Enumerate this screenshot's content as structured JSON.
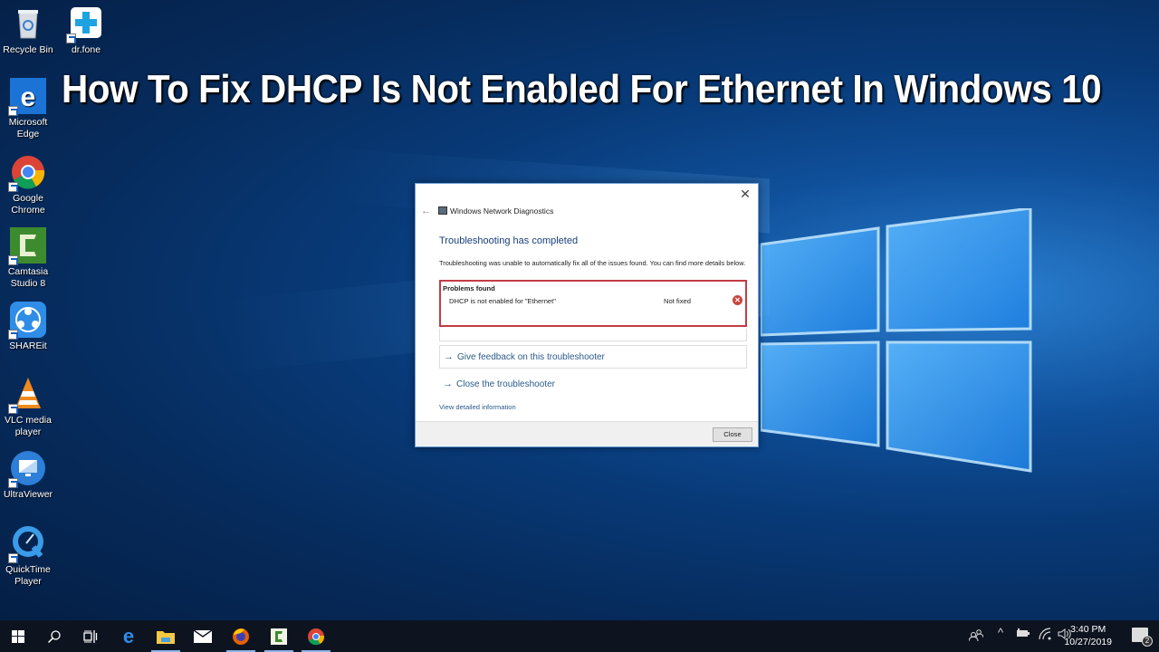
{
  "banner": {
    "title": "How To Fix DHCP Is Not Enabled For Ethernet In Windows 10"
  },
  "desktop_icons": [
    {
      "label": "Recycle Bin",
      "icon": "recycle-bin-icon"
    },
    {
      "label": "dr.fone",
      "icon": "drfone-icon"
    },
    {
      "label": "Microsoft Edge",
      "icon": "edge-icon"
    },
    {
      "label": "Google Chrome",
      "icon": "chrome-icon"
    },
    {
      "label": "Camtasia Studio 8",
      "icon": "camtasia-icon"
    },
    {
      "label": "SHAREit",
      "icon": "shareit-icon"
    },
    {
      "label": "VLC media player",
      "icon": "vlc-icon"
    },
    {
      "label": "UltraViewer",
      "icon": "ultraviewer-icon"
    },
    {
      "label": "QuickTime Player",
      "icon": "quicktime-icon"
    }
  ],
  "dialog": {
    "app_title": "Windows Network Diagnostics",
    "close_glyph": "✕",
    "back_glyph": "←",
    "heading": "Troubleshooting has completed",
    "description": "Troubleshooting was unable to automatically fix all of the issues found. You can find more details below.",
    "problems": {
      "title": "Problems found",
      "items": [
        {
          "name": "DHCP is not enabled for \"Ethernet\"",
          "status": "Not fixed",
          "status_icon": "error-icon"
        }
      ]
    },
    "links": {
      "feedback": "Give feedback on this troubleshooter",
      "close_troubleshooter": "Close the troubleshooter",
      "view_details": "View detailed information"
    },
    "arrow_glyph": "→",
    "close_button": "Close",
    "highlight_color": "#c43b45"
  },
  "taskbar": {
    "items": [
      {
        "name": "start",
        "icon": "windows-start-icon"
      },
      {
        "name": "search",
        "icon": "search-icon"
      },
      {
        "name": "task-view",
        "icon": "task-view-icon"
      },
      {
        "name": "edge",
        "icon": "edge-icon"
      },
      {
        "name": "file-explorer",
        "icon": "folder-icon"
      },
      {
        "name": "mail",
        "icon": "mail-icon"
      },
      {
        "name": "firefox",
        "icon": "firefox-icon"
      },
      {
        "name": "camtasia",
        "icon": "camtasia-icon"
      },
      {
        "name": "chrome",
        "icon": "chrome-icon"
      }
    ],
    "tray": {
      "time": "3:40 PM",
      "date": "10/27/2019",
      "notification_count": "2",
      "chevron": "^"
    }
  }
}
